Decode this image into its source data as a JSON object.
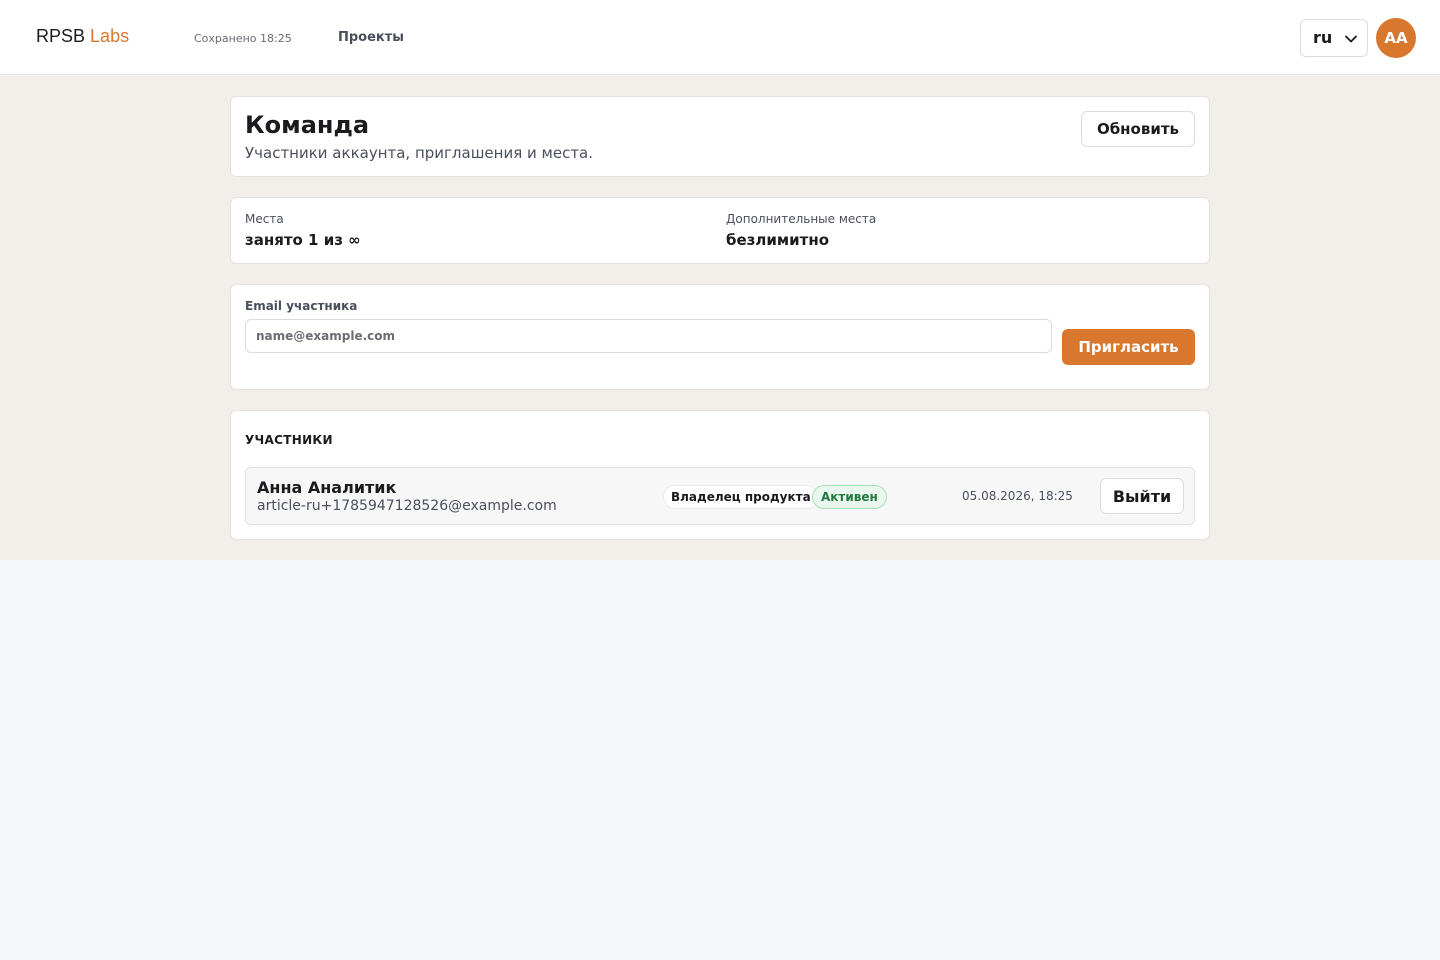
{
  "header": {
    "brand_main": "RPSB",
    "brand_accent": "Labs",
    "saved_status": "Сохранено 18:25",
    "nav_projects": "Проекты",
    "language": "ru",
    "avatar_initials": "AA"
  },
  "team": {
    "title": "Команда",
    "subtitle": "Участники аккаунта, приглашения и места.",
    "refresh_label": "Обновить"
  },
  "seats": {
    "seats_label": "Места",
    "seats_value": "занято 1 из ∞",
    "extra_label": "Дополнительные места",
    "extra_value": "безлимитно"
  },
  "invite": {
    "field_label": "Email участника",
    "placeholder": "name@example.com",
    "value": "",
    "button_label": "Пригласить"
  },
  "members": {
    "section_title": "УЧАСТНИКИ",
    "rows": [
      {
        "name": "Анна Аналитик",
        "email": "article-ru+1785947128526@example.com",
        "role": "Владелец продукта",
        "status": "Активен",
        "date": "05.08.2026, 18:25",
        "action_label": "Выйти"
      }
    ]
  },
  "colors": {
    "accent": "#d9772f",
    "page_band": "#f2efea",
    "status_green": "#1e7a3d"
  }
}
